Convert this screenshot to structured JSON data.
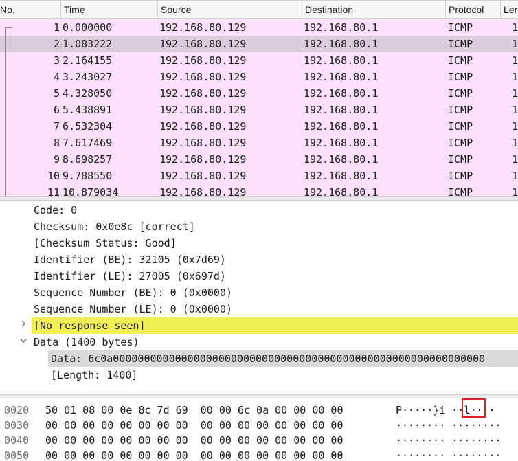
{
  "packet_list": {
    "columns": [
      "No.",
      "Time",
      "Source",
      "Destination",
      "Protocol",
      "Ler"
    ],
    "rows": [
      {
        "no": "1",
        "time": "0.000000",
        "source": "192.168.80.129",
        "destination": "192.168.80.1",
        "protocol": "ICMP",
        "length": "1"
      },
      {
        "no": "2",
        "time": "1.083222",
        "source": "192.168.80.129",
        "destination": "192.168.80.1",
        "protocol": "ICMP",
        "length": "1"
      },
      {
        "no": "3",
        "time": "2.164155",
        "source": "192.168.80.129",
        "destination": "192.168.80.1",
        "protocol": "ICMP",
        "length": "1"
      },
      {
        "no": "4",
        "time": "3.243027",
        "source": "192.168.80.129",
        "destination": "192.168.80.1",
        "protocol": "ICMP",
        "length": "1"
      },
      {
        "no": "5",
        "time": "4.328050",
        "source": "192.168.80.129",
        "destination": "192.168.80.1",
        "protocol": "ICMP",
        "length": "1"
      },
      {
        "no": "6",
        "time": "5.438891",
        "source": "192.168.80.129",
        "destination": "192.168.80.1",
        "protocol": "ICMP",
        "length": "1"
      },
      {
        "no": "7",
        "time": "6.532304",
        "source": "192.168.80.129",
        "destination": "192.168.80.1",
        "protocol": "ICMP",
        "length": "1"
      },
      {
        "no": "8",
        "time": "7.617469",
        "source": "192.168.80.129",
        "destination": "192.168.80.1",
        "protocol": "ICMP",
        "length": "1"
      },
      {
        "no": "9",
        "time": "8.698257",
        "source": "192.168.80.129",
        "destination": "192.168.80.1",
        "protocol": "ICMP",
        "length": "1"
      },
      {
        "no": "10",
        "time": "9.788550",
        "source": "192.168.80.129",
        "destination": "192.168.80.1",
        "protocol": "ICMP",
        "length": "1"
      },
      {
        "no": "11",
        "time": "10.879034",
        "source": "192.168.80.129",
        "destination": "192.168.80.1",
        "protocol": "ICMP",
        "length": "1"
      }
    ]
  },
  "details": {
    "code": "Code: 0",
    "checksum": "Checksum: 0x0e8c [correct]",
    "checksum_status": "[Checksum Status: Good]",
    "identifier_be": "Identifier (BE): 32105 (0x7d69)",
    "identifier_le": "Identifier (LE): 27005 (0x697d)",
    "sequence_be": "Sequence Number (BE): 0 (0x0000)",
    "sequence_le": "Sequence Number (LE): 0 (0x0000)",
    "no_response": "[No response seen]",
    "data_header": "Data (1400 bytes)",
    "data_value": "Data: 6c0a000000000000000000000000000000000000000000000000000000000000",
    "length": "[Length: 1400]"
  },
  "hex_dump": {
    "rows": [
      {
        "offset": "0020",
        "bytes": "50 01 08 00 0e 8c 7d 69  00 00 6c 0a 00 00 00 00",
        "ascii": "P·····}i ··l····"
      },
      {
        "offset": "0030",
        "bytes": "00 00 00 00 00 00 00 00  00 00 00 00 00 00 00 00",
        "ascii": "········ ········"
      },
      {
        "offset": "0040",
        "bytes": "00 00 00 00 00 00 00 00  00 00 00 00 00 00 00 00",
        "ascii": "········ ········"
      },
      {
        "offset": "0050",
        "bytes": "00 00 00 00 00 00 00 00  00 00 00 00 00 00 00 00",
        "ascii": "········ ········"
      }
    ]
  },
  "icons": {
    "collapsed": "chevron-right-icon",
    "expanded": "chevron-down-icon"
  },
  "colors": {
    "row_bg": "#fce0fc",
    "selected_row_bg": "#dccbdc",
    "warning_bg": "#f0f054",
    "field_highlight_bg": "#d9d9d9",
    "annotation_box": "#e02020"
  }
}
